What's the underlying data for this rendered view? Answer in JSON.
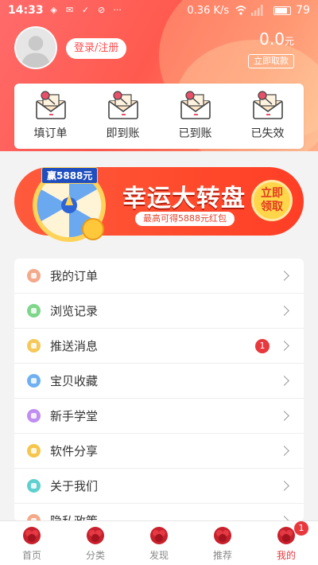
{
  "status_bar": {
    "time": "14:33",
    "speed": "0.36 K/s",
    "battery": "79"
  },
  "profile": {
    "login_label": "登录/注册",
    "balance_value": "0.0",
    "balance_unit": "元",
    "withdraw_label": "立即取款"
  },
  "orders": [
    {
      "label": "填订单",
      "icon": "envelope-rose-icon"
    },
    {
      "label": "即到账",
      "icon": "envelope-rose-icon"
    },
    {
      "label": "已到账",
      "icon": "envelope-rose-icon"
    },
    {
      "label": "已失效",
      "icon": "envelope-rose-icon"
    }
  ],
  "banner": {
    "tag": "赢5888元",
    "title": "幸运大转盘",
    "subtitle": "最高可得5888元红包",
    "cta_line1": "立即",
    "cta_line2": "领取"
  },
  "menu": [
    {
      "label": "我的订单",
      "color": "#f3a98a"
    },
    {
      "label": "浏览记录",
      "color": "#7fd68a"
    },
    {
      "label": "推送消息",
      "color": "#f6c85a",
      "badge": "1"
    },
    {
      "label": "宝贝收藏",
      "color": "#6fb0f2"
    },
    {
      "label": "新手学堂",
      "color": "#c08ef0"
    },
    {
      "label": "软件分享",
      "color": "#f5c54e"
    },
    {
      "label": "关于我们",
      "color": "#5fcfd0"
    },
    {
      "label": "隐私政策",
      "color": "#f3a98a"
    }
  ],
  "tabs": [
    {
      "label": "首页"
    },
    {
      "label": "分类"
    },
    {
      "label": "发现"
    },
    {
      "label": "推荐"
    },
    {
      "label": "我的",
      "badge": "1"
    }
  ],
  "colors": {
    "accent": "#e8383d",
    "header": "#ff5a4e"
  }
}
